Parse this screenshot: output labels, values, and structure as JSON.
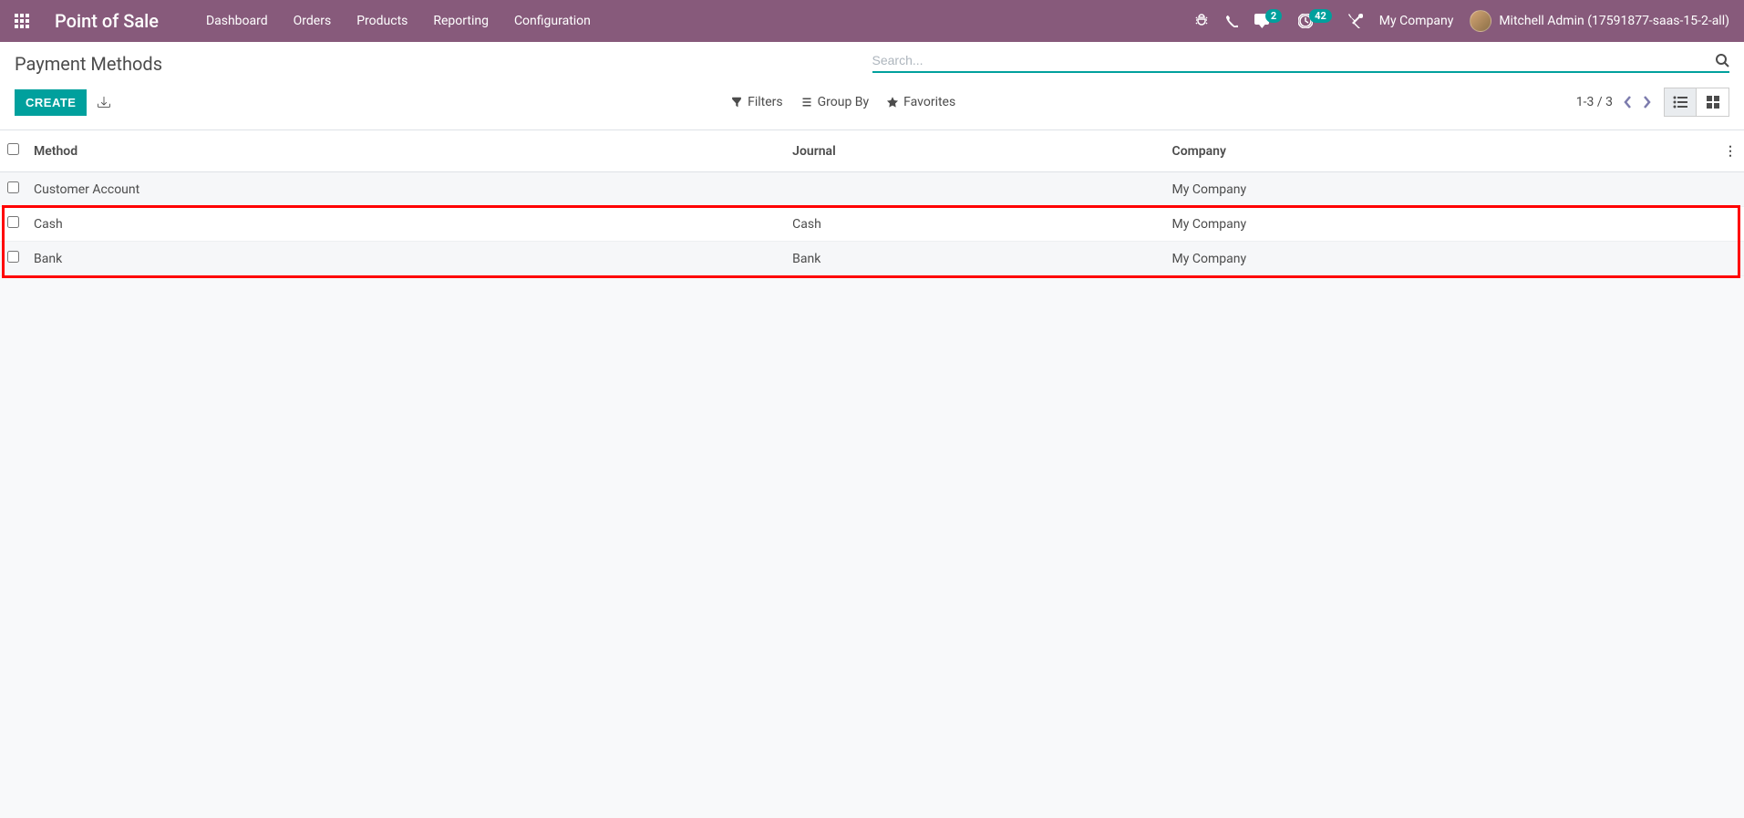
{
  "navbar": {
    "brand": "Point of Sale",
    "menu": [
      "Dashboard",
      "Orders",
      "Products",
      "Reporting",
      "Configuration"
    ],
    "messages_badge": "2",
    "activities_badge": "42",
    "company": "My Company",
    "user": "Mitchell Admin (17591877-saas-15-2-all)"
  },
  "page": {
    "title": "Payment Methods",
    "create_label": "CREATE",
    "search_placeholder": "Search..."
  },
  "toolbar": {
    "filters": "Filters",
    "groupby": "Group By",
    "favorites": "Favorites",
    "pager": "1-3 / 3"
  },
  "table": {
    "headers": {
      "method": "Method",
      "journal": "Journal",
      "company": "Company"
    },
    "rows": [
      {
        "method": "Customer Account",
        "journal": "",
        "company": "My Company"
      },
      {
        "method": "Cash",
        "journal": "Cash",
        "company": "My Company"
      },
      {
        "method": "Bank",
        "journal": "Bank",
        "company": "My Company"
      }
    ]
  }
}
